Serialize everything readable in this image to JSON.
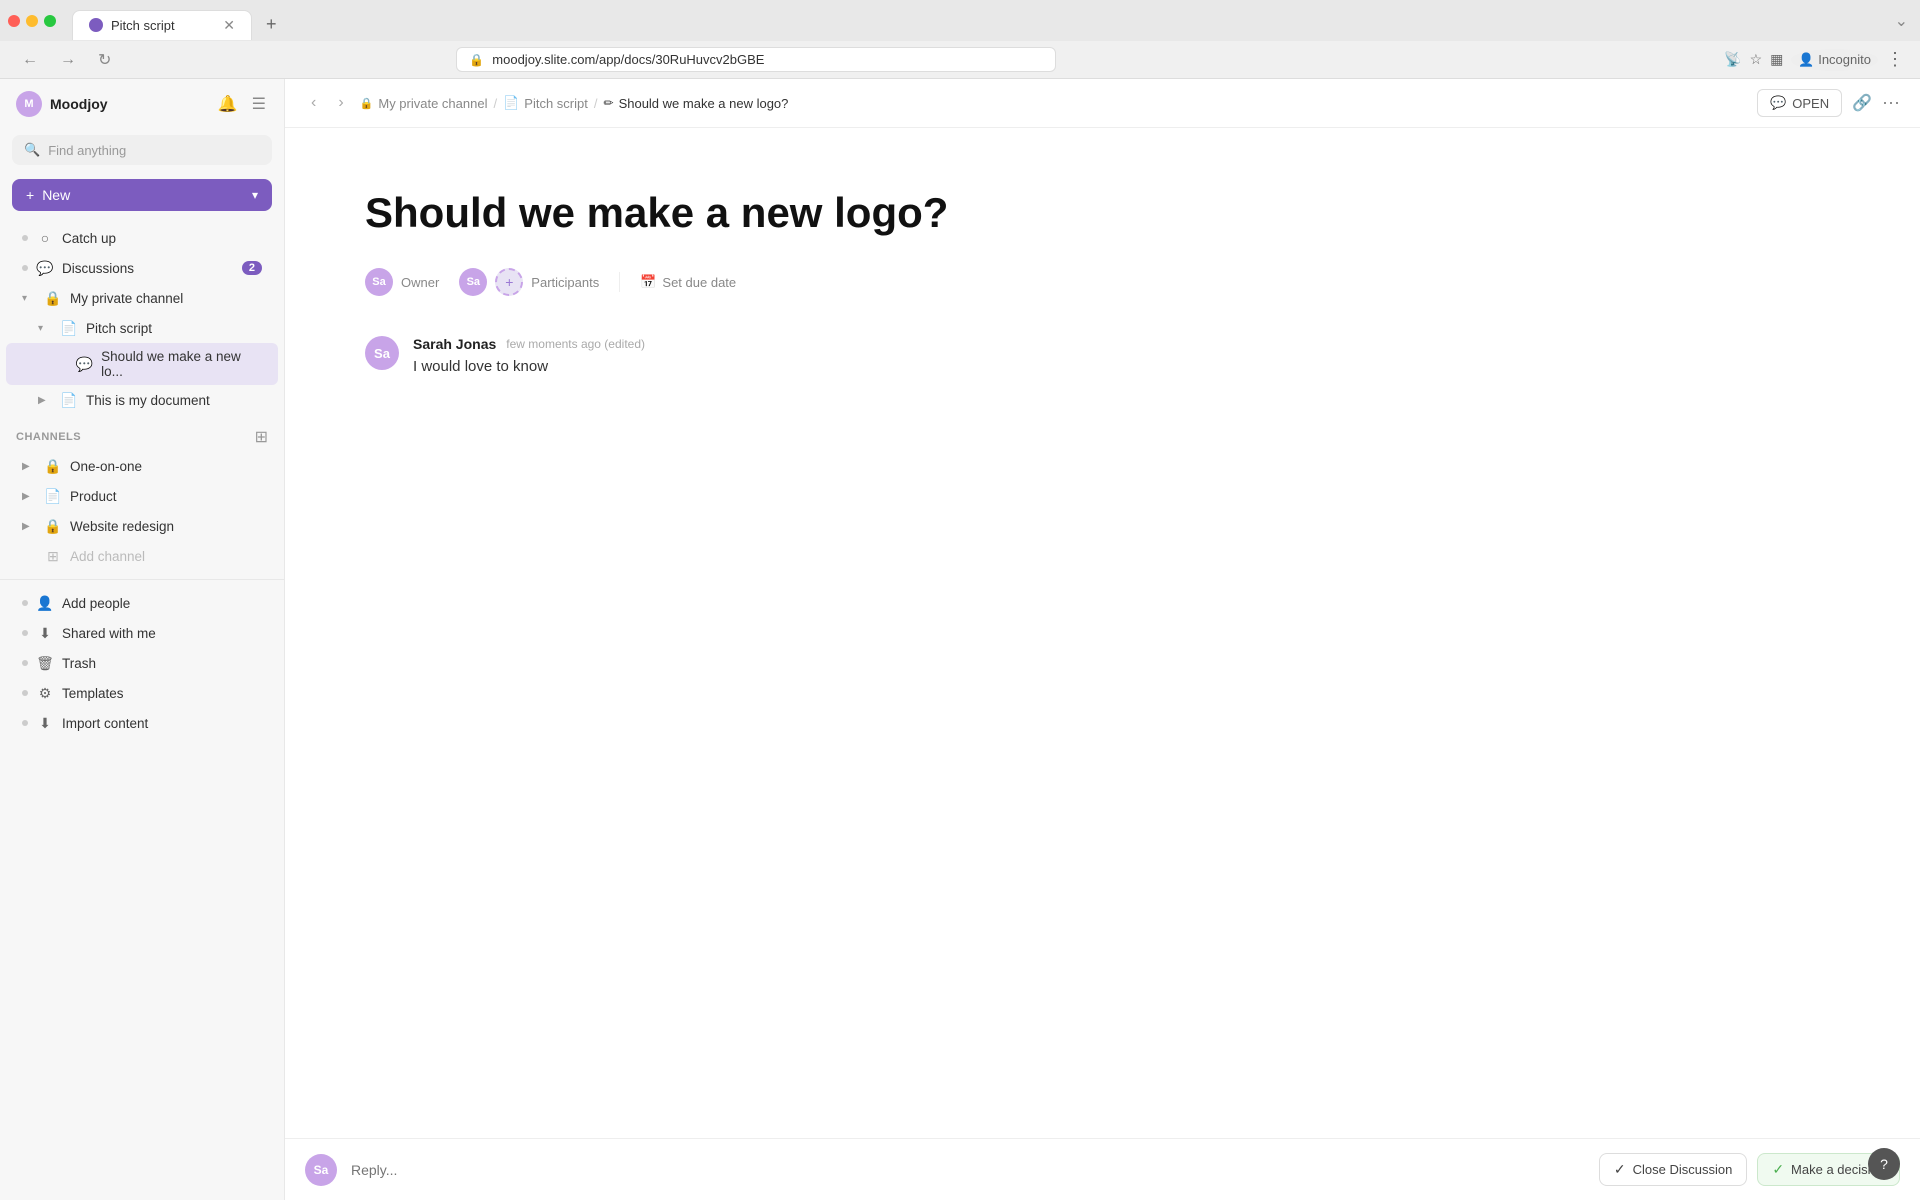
{
  "browser": {
    "tab_title": "Pitch script",
    "url": "moodjoy.slite.com/app/docs/30RuHuvcv2bGBE",
    "favicon_initials": "P"
  },
  "sidebar": {
    "workspace_name": "Moodjoy",
    "workspace_initials": "M",
    "search_placeholder": "Find anything",
    "new_button_label": "New",
    "nav_items": [
      {
        "label": "Catch up",
        "icon": "●",
        "indent": 0,
        "badge": ""
      },
      {
        "label": "Discussions",
        "icon": "💬",
        "indent": 0,
        "badge": "2"
      },
      {
        "label": "My private channel",
        "icon": "🔒",
        "indent": 0,
        "badge": "",
        "expanded": true
      },
      {
        "label": "Pitch script",
        "icon": "📄",
        "indent": 1,
        "badge": "",
        "expanded": true
      },
      {
        "label": "Should we make a new lo...",
        "icon": "💬",
        "indent": 2,
        "badge": "",
        "active": true
      },
      {
        "label": "This is my document",
        "icon": "📄",
        "indent": 1,
        "badge": ""
      }
    ],
    "channels_label": "Channels",
    "channels": [
      {
        "label": "One-on-one",
        "icon": "🔒",
        "indent": 0
      },
      {
        "label": "Product",
        "icon": "📄",
        "indent": 0
      },
      {
        "label": "Website redesign",
        "icon": "🔒",
        "indent": 0
      },
      {
        "label": "Add channel",
        "icon": "➕",
        "indent": 0,
        "muted": true
      }
    ],
    "bottom_items": [
      {
        "label": "Add people",
        "icon": "👤"
      },
      {
        "label": "Shared with me",
        "icon": "⬇"
      },
      {
        "label": "Trash",
        "icon": "🗑"
      },
      {
        "label": "Templates",
        "icon": "⚙"
      },
      {
        "label": "Import content",
        "icon": "⬇"
      }
    ]
  },
  "breadcrumb": {
    "channel": "My private channel",
    "doc": "Pitch script",
    "discussion": "Should we make a new logo?"
  },
  "top_nav": {
    "open_label": "OPEN",
    "open_icon": "💬"
  },
  "discussion": {
    "title": "Should we make a new logo?",
    "owner_label": "Owner",
    "participants_label": "Participants",
    "due_date_label": "Set due date",
    "owner_initials": "Sa",
    "participant_initials": "Sa",
    "messages": [
      {
        "author": "Sarah Jonas",
        "initials": "Sa",
        "time": "few moments ago (edited)",
        "text": "I would love to know"
      }
    ],
    "reply_placeholder": "Reply...",
    "reply_initials": "Sa",
    "close_discussion_label": "Close Discussion",
    "make_decision_label": "Make a decision"
  }
}
